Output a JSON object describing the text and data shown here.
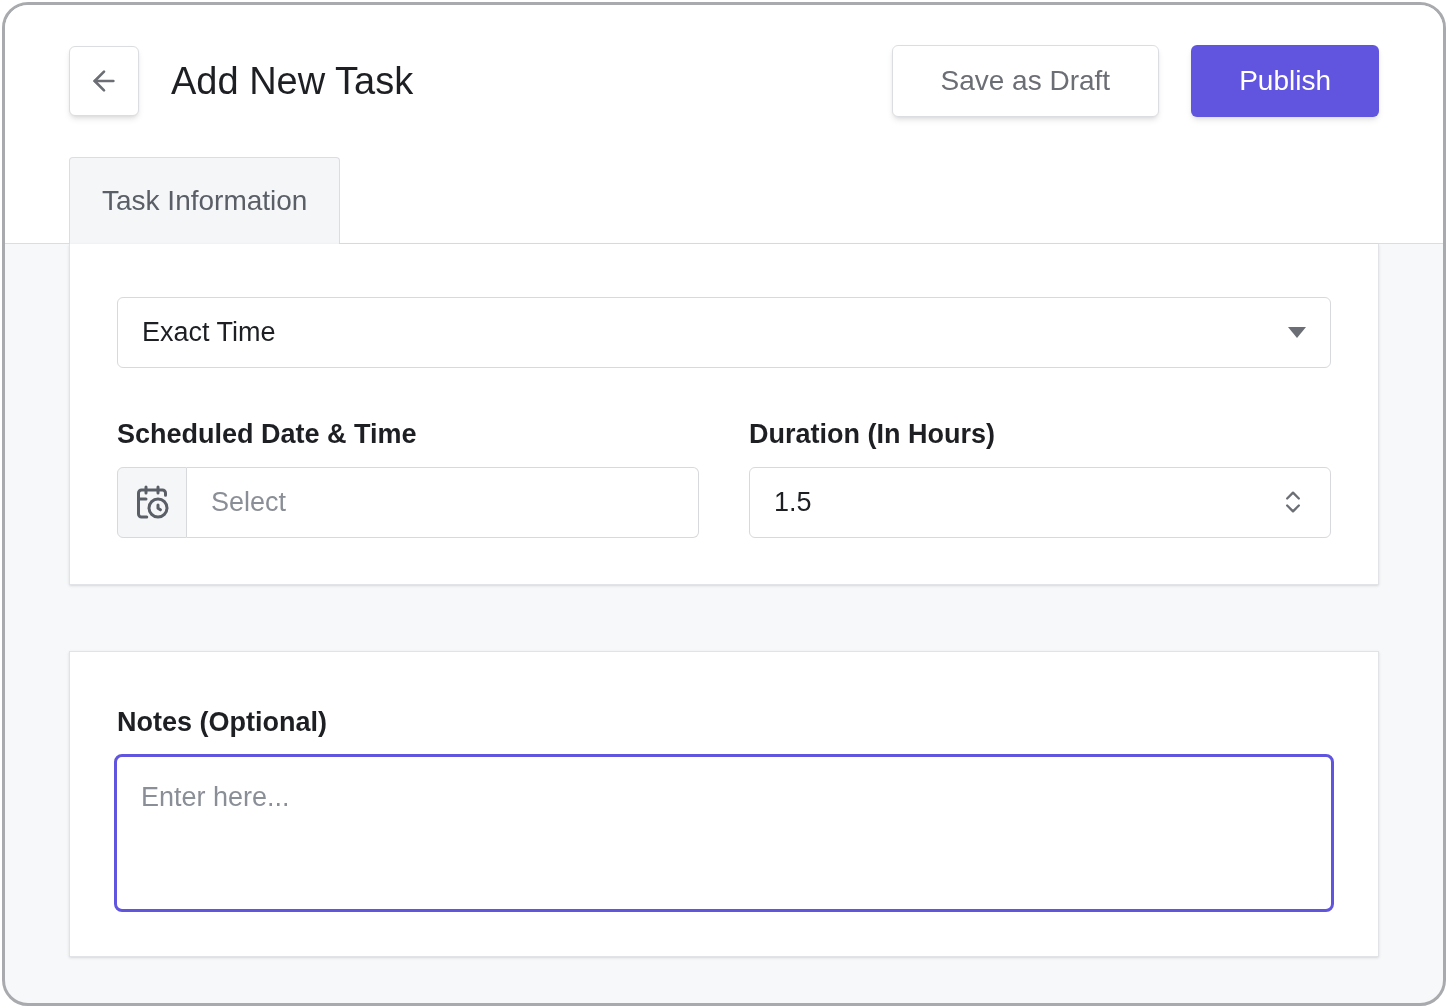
{
  "header": {
    "title": "Add New Task",
    "buttons": [
      {
        "label": "Save as Draft",
        "kind": "secondary"
      },
      {
        "label": "Publish",
        "kind": "primary"
      }
    ]
  },
  "tabs": [
    {
      "label": "Task Information",
      "selected": true
    }
  ],
  "schedule": {
    "type_select": {
      "value": "Exact Time"
    },
    "date_field": {
      "label": "Scheduled Date & Time",
      "placeholder": "Select"
    },
    "duration_field": {
      "label": "Duration (In Hours)",
      "value": "1.5"
    }
  },
  "notes": {
    "label": "Notes (Optional)",
    "placeholder": "Enter here...",
    "focused": true
  }
}
